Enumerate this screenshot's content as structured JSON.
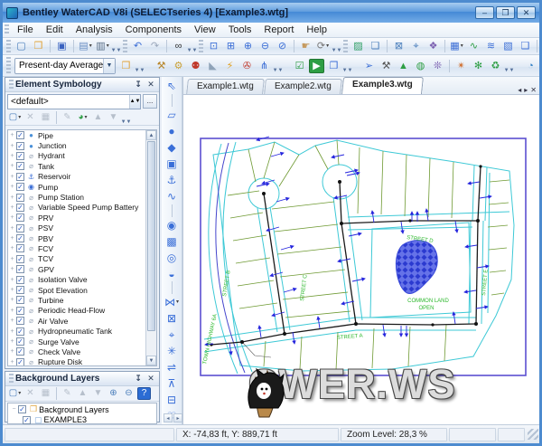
{
  "window": {
    "title": "Bentley WaterCAD V8i (SELECTseries 4) [Example3.wtg]",
    "buttons": [
      {
        "name": "minimize-button",
        "glyph": "–"
      },
      {
        "name": "maximize-button",
        "glyph": "❐"
      },
      {
        "name": "close-button",
        "glyph": "✕"
      }
    ]
  },
  "menu": {
    "items": [
      {
        "label": "File"
      },
      {
        "label": "Edit"
      },
      {
        "label": "Analysis"
      },
      {
        "label": "Components"
      },
      {
        "label": "View"
      },
      {
        "label": "Tools"
      },
      {
        "label": "Report"
      },
      {
        "label": "Help"
      }
    ]
  },
  "toolbar1": {
    "items": [
      {
        "t": "g"
      },
      {
        "t": "b",
        "name": "new-button",
        "g": "▢",
        "c": "#4a7ebb"
      },
      {
        "t": "b",
        "name": "open-button",
        "g": "❒",
        "c": "#e0a33a"
      },
      {
        "t": "s"
      },
      {
        "t": "b",
        "name": "save-button",
        "g": "▣",
        "c": "#3a62c0"
      },
      {
        "t": "s"
      },
      {
        "t": "b",
        "name": "print-preview-button",
        "g": "▤",
        "c": "#6b8fc4",
        "dd": 1
      },
      {
        "t": "b",
        "name": "print-button",
        "g": "▥",
        "c": "#5a6f87",
        "dd": 1
      },
      {
        "t": "o"
      },
      {
        "t": "g"
      },
      {
        "t": "b",
        "name": "undo-button",
        "g": "↶",
        "c": "#3d6fd6"
      },
      {
        "t": "b",
        "name": "redo-button",
        "g": "↷",
        "c": "#9aa7bb"
      },
      {
        "t": "s"
      },
      {
        "t": "b",
        "name": "find-button",
        "g": "∞",
        "c": "#333333"
      },
      {
        "t": "o"
      },
      {
        "t": "g"
      },
      {
        "t": "b",
        "name": "zoom-window-button",
        "g": "⊡",
        "c": "#3d6fd6"
      },
      {
        "t": "b",
        "name": "zoom-extents-button",
        "g": "⊞",
        "c": "#3d6fd6"
      },
      {
        "t": "b",
        "name": "zoom-in-button",
        "g": "⊕",
        "c": "#3d6fd6"
      },
      {
        "t": "b",
        "name": "zoom-out-button",
        "g": "⊖",
        "c": "#3d6fd6"
      },
      {
        "t": "b",
        "name": "zoom-previous-button",
        "g": "⊘",
        "c": "#3d6fd6"
      },
      {
        "t": "s"
      },
      {
        "t": "b",
        "name": "pan-button",
        "g": "☛",
        "c": "#c59a5f"
      },
      {
        "t": "b",
        "name": "refresh-button",
        "g": "⟳",
        "c": "#777777",
        "dd": 1
      },
      {
        "t": "o"
      },
      {
        "t": "g"
      },
      {
        "t": "b",
        "name": "background-image-button",
        "g": "▨",
        "c": "#2e9e64"
      },
      {
        "t": "b",
        "name": "layers-button",
        "g": "❏",
        "c": "#4a7ebb"
      },
      {
        "t": "s"
      },
      {
        "t": "b",
        "name": "aerial-view-button",
        "g": "⊠",
        "c": "#4a7ebb"
      },
      {
        "t": "b",
        "name": "select-by-element-button",
        "g": "⌖",
        "c": "#4a7ebb"
      },
      {
        "t": "b",
        "name": "queries-button",
        "g": "❖",
        "c": "#7a5fb0"
      },
      {
        "t": "s"
      },
      {
        "t": "b",
        "name": "flextables-button",
        "g": "▦",
        "c": "#3d6fd6",
        "dd": 1
      },
      {
        "t": "b",
        "name": "graphs-button",
        "g": "∿",
        "c": "#2e9e44"
      },
      {
        "t": "b",
        "name": "profiles-button",
        "g": "≋",
        "c": "#3d6fd6"
      },
      {
        "t": "b",
        "name": "contours-button",
        "g": "▧",
        "c": "#3d6fd6"
      },
      {
        "t": "b",
        "name": "element-symbology-button",
        "g": "❑",
        "c": "#3d6fd6"
      },
      {
        "t": "s"
      },
      {
        "t": "b",
        "name": "properties-button",
        "g": "▤",
        "c": "#b05c2a"
      },
      {
        "t": "o"
      }
    ]
  },
  "toolbar2": {
    "scenario_combo": {
      "value": "Present-day Average",
      "name": "scenario-select"
    },
    "items": [
      {
        "t": "b",
        "name": "scenarios-button",
        "g": "❒",
        "c": "#e0a33a"
      },
      {
        "t": "o"
      },
      {
        "t": "g"
      },
      {
        "t": "b",
        "name": "alternatives-button",
        "g": "⚒",
        "c": "#b8862a"
      },
      {
        "t": "b",
        "name": "calculation-options-button",
        "g": "⚙",
        "c": "#caa23a"
      },
      {
        "t": "b",
        "name": "user-notifications-button",
        "g": "⚉",
        "c": "#c0392b"
      },
      {
        "t": "b",
        "name": "prototypes-button",
        "g": "◣",
        "c": "#8fa3b8"
      },
      {
        "t": "b",
        "name": "engineering-standards-button",
        "g": "⚡",
        "c": "#e0a020"
      },
      {
        "t": "b",
        "name": "hyperlinks-button",
        "g": "✇",
        "c": "#c0392b"
      },
      {
        "t": "b",
        "name": "network-navigator-button",
        "g": "⋔",
        "c": "#3d6fd6"
      },
      {
        "t": "o"
      },
      {
        "t": "g"
      },
      {
        "t": "b",
        "name": "validate-button",
        "g": "☑",
        "c": "#2e9e44"
      },
      {
        "t": "b",
        "name": "compute-button",
        "g": "▶",
        "c": "#ffffff",
        "bg": "#2e9e44"
      },
      {
        "t": "b",
        "name": "compute-center-button",
        "g": "❐",
        "c": "#3d6fd6"
      },
      {
        "t": "o"
      },
      {
        "t": "g"
      },
      {
        "t": "b",
        "name": "selection-sets-button",
        "g": "➢",
        "c": "#3d6fd6"
      },
      {
        "t": "b",
        "name": "darwin-calibrator-button",
        "g": "⚒",
        "c": "#555555"
      },
      {
        "t": "b",
        "name": "terrain-extractor-button",
        "g": "▲",
        "c": "#2e9e44"
      },
      {
        "t": "b",
        "name": "thematic-mapping-button",
        "g": "◍",
        "c": "#2e9e44"
      },
      {
        "t": "b",
        "name": "animation-button",
        "g": "❊",
        "c": "#7a5fb0"
      },
      {
        "t": "s"
      },
      {
        "t": "b",
        "name": "pushpin-button",
        "g": "✴",
        "c": "#d07030"
      },
      {
        "t": "b",
        "name": "external-tools-button",
        "g": "✻",
        "c": "#2e9e44"
      },
      {
        "t": "b",
        "name": "web-services-button",
        "g": "♻",
        "c": "#2e9e44"
      },
      {
        "t": "o"
      },
      {
        "t": "g"
      },
      {
        "t": "b",
        "name": "bentley-cloud-button",
        "g": "◔",
        "c": "#2e7ec4"
      },
      {
        "t": "o"
      }
    ]
  },
  "symbology_panel": {
    "title": "Element Symbology",
    "titlebar_buttons": [
      {
        "name": "pin-button",
        "glyph": "↧"
      },
      {
        "name": "close-panel-button",
        "glyph": "✕"
      }
    ],
    "preset": {
      "value": "<default>",
      "browse_label": "..."
    },
    "tools": [
      {
        "t": "b",
        "name": "new-symbology-button",
        "g": "▢",
        "c": "#4a7ebb",
        "dd": 1
      },
      {
        "t": "b",
        "name": "delete-symbology-button",
        "g": "✕",
        "c": "#b6bfcb"
      },
      {
        "t": "b",
        "name": "rename-symbology-button",
        "g": "▦",
        "c": "#b6bfcb"
      },
      {
        "t": "s"
      },
      {
        "t": "b",
        "name": "edit-annotation-button",
        "g": "✎",
        "c": "#b6bfcb"
      },
      {
        "t": "b",
        "name": "color-coding-button",
        "g": "◕",
        "c": "#2e9e44",
        "dd": 1
      },
      {
        "t": "b",
        "name": "move-up-button",
        "g": "▲",
        "c": "#b6bfcb"
      },
      {
        "t": "b",
        "name": "move-down-button",
        "g": "▼",
        "c": "#b6bfcb"
      },
      {
        "t": "o"
      }
    ],
    "items": [
      {
        "label": "Pipe",
        "icon": "●",
        "ic": "#4a90d8"
      },
      {
        "label": "Junction",
        "icon": "●",
        "ic": "#4a90d8"
      },
      {
        "label": "Hydrant",
        "icon": "⌀",
        "ic": "#9aa7b8"
      },
      {
        "label": "Tank",
        "icon": "⌀",
        "ic": "#9aa7b8"
      },
      {
        "label": "Reservoir",
        "icon": "⚓",
        "ic": "#3d6fd6"
      },
      {
        "label": "Pump",
        "icon": "◉",
        "ic": "#3d6fd6"
      },
      {
        "label": "Pump Station",
        "icon": "⌀",
        "ic": "#9aa7b8"
      },
      {
        "label": "Variable Speed Pump Battery",
        "icon": "⌀",
        "ic": "#9aa7b8"
      },
      {
        "label": "PRV",
        "icon": "⌀",
        "ic": "#9aa7b8"
      },
      {
        "label": "PSV",
        "icon": "⌀",
        "ic": "#9aa7b8"
      },
      {
        "label": "PBV",
        "icon": "⌀",
        "ic": "#9aa7b8"
      },
      {
        "label": "FCV",
        "icon": "⌀",
        "ic": "#9aa7b8"
      },
      {
        "label": "TCV",
        "icon": "⌀",
        "ic": "#9aa7b8"
      },
      {
        "label": "GPV",
        "icon": "⌀",
        "ic": "#9aa7b8"
      },
      {
        "label": "Isolation Valve",
        "icon": "⌀",
        "ic": "#9aa7b8"
      },
      {
        "label": "Spot Elevation",
        "icon": "⌀",
        "ic": "#9aa7b8"
      },
      {
        "label": "Turbine",
        "icon": "⌀",
        "ic": "#9aa7b8"
      },
      {
        "label": "Periodic Head-Flow",
        "icon": "⌀",
        "ic": "#9aa7b8"
      },
      {
        "label": "Air Valve",
        "icon": "⌀",
        "ic": "#9aa7b8"
      },
      {
        "label": "Hydropneumatic Tank",
        "icon": "⌀",
        "ic": "#9aa7b8"
      },
      {
        "label": "Surge Valve",
        "icon": "⌀",
        "ic": "#9aa7b8"
      },
      {
        "label": "Check Valve",
        "icon": "⌀",
        "ic": "#9aa7b8"
      },
      {
        "label": "Rupture Disk",
        "icon": "⌀",
        "ic": "#9aa7b8"
      }
    ]
  },
  "background_panel": {
    "title": "Background Layers",
    "titlebar_buttons": [
      {
        "name": "pin-button",
        "glyph": "↧"
      },
      {
        "name": "close-panel-button",
        "glyph": "✕"
      }
    ],
    "tools": [
      {
        "t": "b",
        "name": "new-layer-button",
        "g": "▢",
        "c": "#4a7ebb",
        "dd": 1
      },
      {
        "t": "b",
        "name": "delete-layer-button",
        "g": "✕",
        "c": "#b6bfcb"
      },
      {
        "t": "b",
        "name": "rename-layer-button",
        "g": "▦",
        "c": "#b6bfcb"
      },
      {
        "t": "s"
      },
      {
        "t": "b",
        "name": "edit-layer-button",
        "g": "✎",
        "c": "#b6bfcb"
      },
      {
        "t": "b",
        "name": "move-up-button",
        "g": "▲",
        "c": "#b6bfcb"
      },
      {
        "t": "b",
        "name": "move-down-button",
        "g": "▼",
        "c": "#b6bfcb"
      },
      {
        "t": "b",
        "name": "expand-all-button",
        "g": "⊕",
        "c": "#4a7ebb"
      },
      {
        "t": "b",
        "name": "collapse-all-button",
        "g": "⊖",
        "c": "#4a7ebb"
      },
      {
        "t": "b",
        "name": "help-button",
        "g": "?",
        "c": "#ffffff",
        "bg": "#2b6cd4"
      }
    ],
    "tree": {
      "root": "Background Layers",
      "child": "EXAMPLE3"
    }
  },
  "draw_toolbar": {
    "items": [
      {
        "t": "b",
        "name": "select-tool-button",
        "g": "⇖"
      },
      {
        "t": "s"
      },
      {
        "t": "b",
        "name": "pipe-tool-button",
        "g": "▱"
      },
      {
        "t": "b",
        "name": "junction-tool-button",
        "g": "●"
      },
      {
        "t": "b",
        "name": "hydrant-tool-button",
        "g": "◆"
      },
      {
        "t": "b",
        "name": "tank-tool-button",
        "g": "▣"
      },
      {
        "t": "b",
        "name": "reservoir-tool-button",
        "g": "⚓"
      },
      {
        "t": "b",
        "name": "lateral-tool-button",
        "g": "∿"
      },
      {
        "t": "s"
      },
      {
        "t": "b",
        "name": "pump-tool-button",
        "g": "◉"
      },
      {
        "t": "b",
        "name": "pump-station-tool-button",
        "g": "▩"
      },
      {
        "t": "b",
        "name": "variable-speed-pump-tool-button",
        "g": "◎"
      },
      {
        "t": "b",
        "name": "customer-meter-tool-button",
        "g": "◒"
      },
      {
        "t": "s"
      },
      {
        "t": "b",
        "name": "valve-tool-button",
        "g": "⋈",
        "dd": 1
      },
      {
        "t": "b",
        "name": "isolation-valve-tool-button",
        "g": "⊠"
      },
      {
        "t": "b",
        "name": "spot-elevation-tool-button",
        "g": "⌖"
      },
      {
        "t": "b",
        "name": "turbine-tool-button",
        "g": "✳"
      },
      {
        "t": "b",
        "name": "periodic-head-flow-tool-button",
        "g": "⇌"
      },
      {
        "t": "b",
        "name": "air-valve-tool-button",
        "g": "⊼"
      },
      {
        "t": "b",
        "name": "hydro-tank-tool-button",
        "g": "⊟"
      },
      {
        "t": "b",
        "name": "surge-valve-tool-button",
        "g": "♡"
      }
    ]
  },
  "tabs": {
    "items": [
      {
        "label": "Example1.wtg",
        "active": false
      },
      {
        "label": "Example2.wtg",
        "active": false
      },
      {
        "label": "Example3.wtg",
        "active": true
      }
    ],
    "nav": [
      {
        "name": "tab-scroll-left-button",
        "glyph": "◂"
      },
      {
        "name": "tab-scroll-right-button",
        "glyph": "▸"
      },
      {
        "name": "tab-close-button",
        "glyph": "✕"
      }
    ]
  },
  "map": {
    "labels": {
      "street_a": "STREET A",
      "street_b": "STREET B",
      "street_c": "STREET C",
      "street_d": "STREET D",
      "street_e": "STREET E",
      "common_land_line1": "COMMON LAND",
      "common_land_line2": "OPEN",
      "highway": "TOWN HIGHWAY 6A"
    },
    "colors": {
      "parcel": "#3ec9d6",
      "lot": "#6f9a33",
      "pipe": "#1a1a1a",
      "arrow": "#2525dd",
      "frame": "#5b4fd0",
      "pond": "#6572e8",
      "pond_dot": "#2b3ad0",
      "label": "#2db82d",
      "road_center": "#4444cc"
    }
  },
  "watermark": {
    "text": "CWER.WS"
  },
  "status": {
    "coords": "X: -74,83 ft, Y: 889,71 ft",
    "zoom": "Zoom Level: 28,3 %"
  }
}
